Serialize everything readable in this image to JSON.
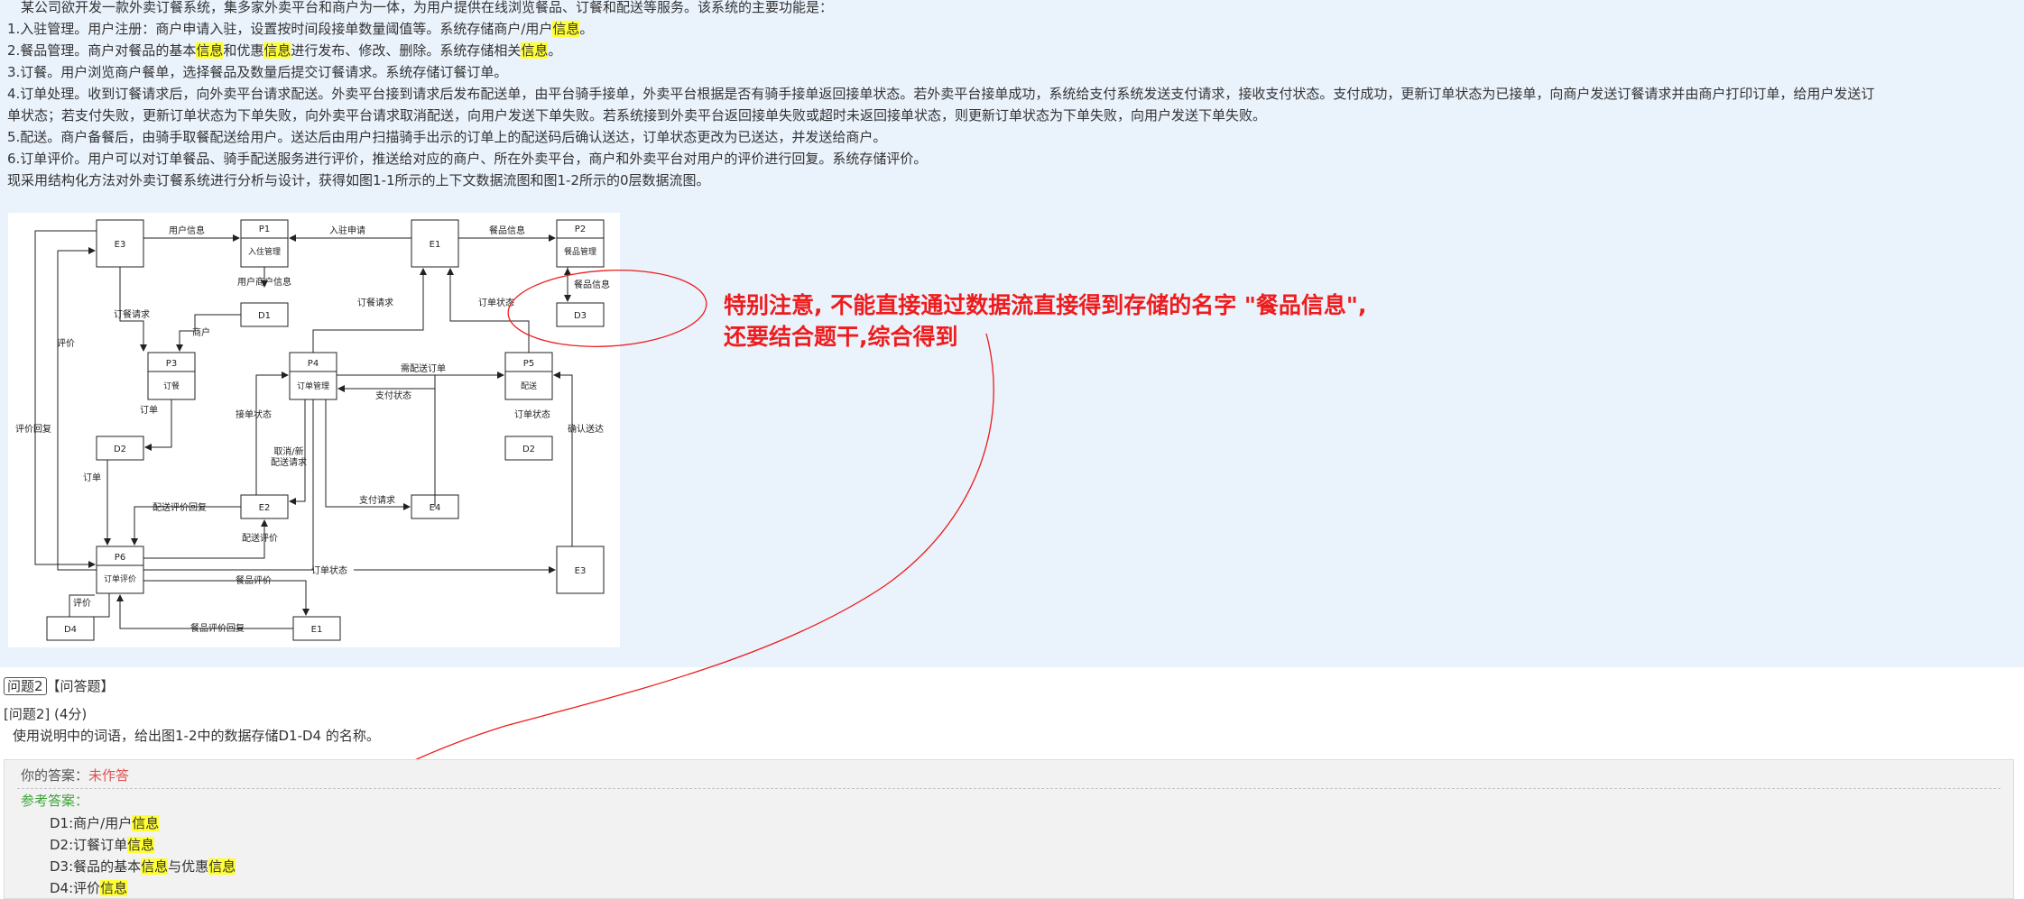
{
  "intro": {
    "lines": [
      [
        {
          "t": "　某公司欲开发一款外卖订餐系统，集多家外卖平台和商户为一体，为用户提供在线浏览餐品、订餐和配送等服务。该系统的主要功能是："
        }
      ],
      [
        {
          "t": "1.入驻管理。用户注册：商户申请入驻，设置按时间段接单数量阈值等。系统存储商户/用户"
        },
        {
          "t": "信息",
          "h": true
        },
        {
          "t": "。"
        }
      ],
      [
        {
          "t": "2.餐品管理。商户对餐品的基本"
        },
        {
          "t": "信息",
          "h": true
        },
        {
          "t": "和优惠"
        },
        {
          "t": "信息",
          "h": true
        },
        {
          "t": "进行发布、修改、删除。系统存储相关"
        },
        {
          "t": "信息",
          "h": true
        },
        {
          "t": "。"
        }
      ],
      [
        {
          "t": "3.订餐。用户浏览商户餐单，选择餐品及数量后提交订餐请求。系统存储订餐订单。"
        }
      ],
      [
        {
          "t": "4.订单处理。收到订餐请求后，向外卖平台请求配送。外卖平台接到请求后发布配送单，由平台骑手接单，外卖平台根据是否有骑手接单返回接单状态。若外卖平台接单成功，系统给支付系统发送支付请求，接收支付状态。支付成功，更新订单状态为已接单，向商户发送订餐请求并由商户打印订单，给用户发送订"
        }
      ],
      [
        {
          "t": "单状态；若支付失败，更新订单状态为下单失败，向外卖平台请求取消配送，向用户发送下单失败。若系统接到外卖平台返回接单失败或超时未返回接单状态，则更新订单状态为下单失败，向用户发送下单失败。"
        }
      ],
      [
        {
          "t": "5.配送。商户备餐后，由骑手取餐配送给用户。送达后由用户扫描骑手出示的订单上的配送码后确认送达，订单状态更改为已送达，并发送给商户。"
        }
      ],
      [
        {
          "t": "6.订单评价。用户可以对订单餐品、骑手配送服务进行评价，推送给对应的商户、所在外卖平台，商户和外卖平台对用户的评价进行回复。系统存储评价。"
        }
      ],
      [
        {
          "t": "现采用结构化方法对外卖订餐系统进行分析与设计，获得如图1-1所示的上下文数据流图和图1-2所示的0层数据流图。"
        }
      ]
    ]
  },
  "diagram": {
    "nodes": {
      "p1_id": "P1",
      "p1_name": "入住管理",
      "p2_id": "P2",
      "p2_name": "餐品管理",
      "p3_id": "P3",
      "p3_name": "订餐",
      "p4_id": "P4",
      "p4_name": "订单管理",
      "p5_id": "P5",
      "p5_name": "配送",
      "p6_id": "P6",
      "p6_name": "订单评价",
      "e3_top": "E3",
      "e1_top": "E1",
      "e2": "E2",
      "e4": "E4",
      "e3_bottom": "E3",
      "e1_bottom": "E1",
      "d1": "D1",
      "d2_left": "D2",
      "d3": "D3",
      "d2_right": "D2",
      "d4": "D4"
    },
    "flows": {
      "user_info": "用户信息",
      "apply": "入驻申请",
      "meal_info_e1": "餐品信息",
      "user_merchant_info": "用户商户信息",
      "meal_info_d3": "餐品信息",
      "order_req_left": "订餐请求",
      "merchant": "商户",
      "order_req_e1": "订餐请求",
      "order_status_e1": "订单状态",
      "eval": "评价",
      "eval_reply": "评价回复",
      "order_p3": "订单",
      "order_d2": "订单",
      "delivery_order": "需配送订单",
      "pay_status": "支付状态",
      "accept_status": "接单状态",
      "order_status_p5": "订单状态",
      "confirm_delivery": "确认送达",
      "cancel_req_1": "取消/新",
      "cancel_req_2": "配送请求",
      "pay_req": "支付请求",
      "delivery_eval_reply": "配送评价回复",
      "delivery_eval": "配送评价",
      "order_status_e3": "订单状态",
      "meal_eval": "餐品评价",
      "eval_d4": "评价",
      "meal_eval_reply": "餐品评价回复"
    }
  },
  "annotation": {
    "line1": "特别注意, 不能直接通过数据流直接得到存储的名字 \"餐品信息\",",
    "line2": "还要结合题干,综合得到",
    "color": "#ee1c1c"
  },
  "question": {
    "tag": "问题2",
    "type": "【问答题】",
    "title": "[问题2] (4分)",
    "body": "使用说明中的词语，给出图1-2中的数据存储D1-D4 的名称。"
  },
  "answer": {
    "your_label": "你的答案：",
    "your_value": "未作答",
    "ref_label": "参考答案：",
    "lines": [
      [
        {
          "t": "D1:商户/用户"
        },
        {
          "t": "信息",
          "h": true
        }
      ],
      [
        {
          "t": "D2:订餐订单"
        },
        {
          "t": "信息",
          "h": true
        }
      ],
      [
        {
          "t": "D3:餐品的基本"
        },
        {
          "t": "信息",
          "h": true
        },
        {
          "t": "与优惠"
        },
        {
          "t": "信息",
          "h": true
        }
      ],
      [
        {
          "t": "D4:评价"
        },
        {
          "t": "信息",
          "h": true
        }
      ]
    ]
  }
}
